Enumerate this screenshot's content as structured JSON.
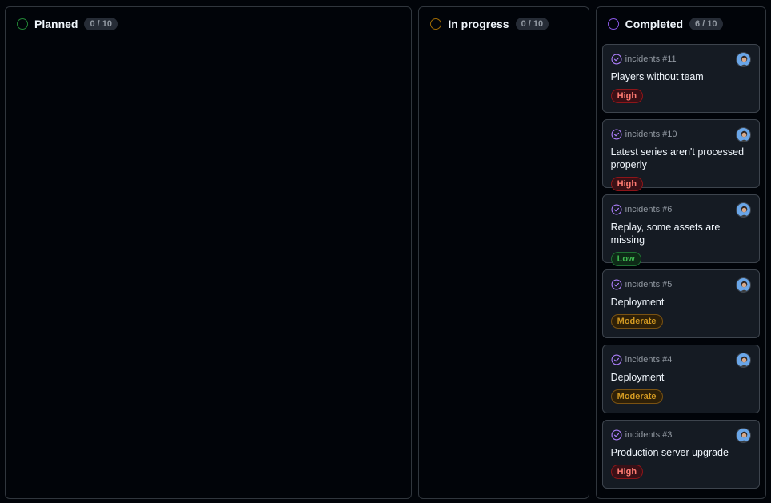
{
  "columns": [
    {
      "title": "Planned",
      "count": "0 / 10",
      "dot_color": "#238636"
    },
    {
      "title": "In progress",
      "count": "0 / 10",
      "dot_color": "#9e6a03"
    },
    {
      "title": "Completed",
      "count": "6 / 10",
      "dot_color": "#8957e5"
    }
  ],
  "cards": [
    {
      "ref": "incidents #11",
      "title": "Players without team",
      "label": "High",
      "label_type": "high",
      "icon": "check-circle-icon"
    },
    {
      "ref": "incidents #10",
      "title": "Latest series aren't processed properly",
      "label": "High",
      "label_type": "high",
      "icon": "check-circle-icon"
    },
    {
      "ref": "incidents #6",
      "title": "Replay, some assets are missing",
      "label": "Low",
      "label_type": "low",
      "icon": "check-circle-icon"
    },
    {
      "ref": "incidents #5",
      "title": "Deployment",
      "label": "Moderate",
      "label_type": "moderate",
      "icon": "check-circle-icon"
    },
    {
      "ref": "incidents #4",
      "title": "Deployment",
      "label": "Moderate",
      "label_type": "moderate",
      "icon": "check-circle-icon"
    },
    {
      "ref": "incidents #3",
      "title": "Production server upgrade",
      "label": "High",
      "label_type": "high",
      "icon": "check-circle-icon"
    }
  ],
  "colors": {
    "background": "#010409",
    "card": "#151b23",
    "border": "#30363d",
    "completed_icon": "#ab7df8"
  }
}
